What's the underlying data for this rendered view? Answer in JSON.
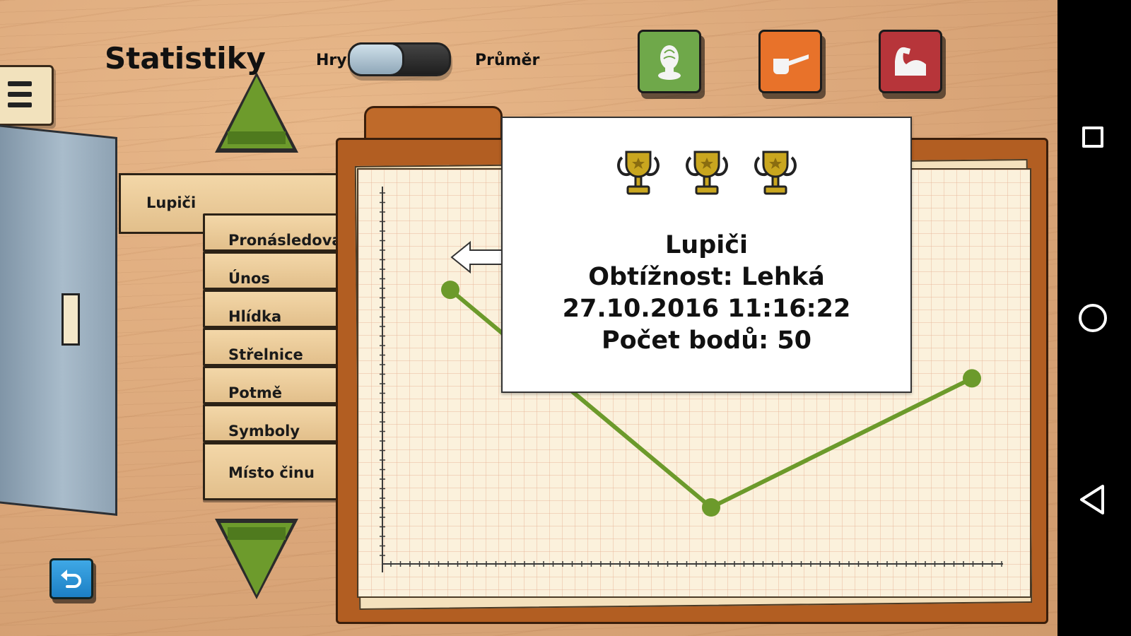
{
  "header": {
    "title": "Statistiky",
    "toggle_left": "Hry",
    "toggle_right": "Průměr"
  },
  "category_buttons": [
    {
      "name": "fingerprint-icon",
      "color": "#6fa84a"
    },
    {
      "name": "pipe-icon",
      "color": "#e8722a"
    },
    {
      "name": "muscle-arm-icon",
      "color": "#b7353a"
    }
  ],
  "list": {
    "main_item": "Lupiči",
    "items": [
      "Pronásledování",
      "Únos",
      "Hlídka",
      "Střelnice",
      "Potmě",
      "Symboly",
      "Místo činu"
    ]
  },
  "popup": {
    "trophy_count": 3,
    "title": "Lupiči",
    "difficulty": "Obtížnost: Lehká",
    "datetime": "27.10.2016 11:16:22",
    "score": "Počet bodů: 50"
  },
  "chart_data": {
    "type": "line",
    "series": [
      {
        "values": [
          0.86,
          0.0,
          0.51
        ]
      }
    ],
    "color": "#6c9a2b",
    "selected_point_index": 0
  },
  "colors": {
    "line": "#6c9a2b",
    "arrow_green": "#6d9b2c",
    "back_button": "#2b93d7"
  }
}
